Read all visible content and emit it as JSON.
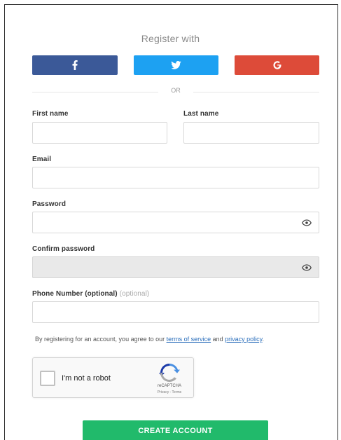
{
  "register": {
    "title": "Register with",
    "social": {
      "facebook_icon": "facebook-icon",
      "twitter_icon": "twitter-icon",
      "google_icon": "google-icon",
      "facebook_color": "#3b5998",
      "twitter_color": "#1da1f2",
      "google_color": "#dd4b39"
    },
    "divider_text": "OR"
  },
  "form": {
    "first_name": {
      "label": "First name",
      "value": ""
    },
    "last_name": {
      "label": "Last name",
      "value": ""
    },
    "email": {
      "label": "Email",
      "value": ""
    },
    "password": {
      "label": "Password",
      "value": "",
      "toggle_icon": "eye-icon"
    },
    "confirm_password": {
      "label": "Confirm password",
      "value": "",
      "toggle_icon": "eye-icon"
    },
    "phone": {
      "label": "Phone Number (optional)",
      "optional_suffix": "(optional)",
      "value": ""
    }
  },
  "terms": {
    "prefix": "By registering for an account, you agree to our ",
    "terms_link": "terms of service",
    "conjunction": " and ",
    "privacy_link": "privacy policy",
    "suffix": "."
  },
  "captcha": {
    "label": "I'm not a robot",
    "brand": "reCAPTCHA",
    "links": "Privacy - Terms",
    "icon": "recaptcha-icon"
  },
  "submit": {
    "label": "CREATE ACCOUNT",
    "color": "#21ba6b"
  }
}
